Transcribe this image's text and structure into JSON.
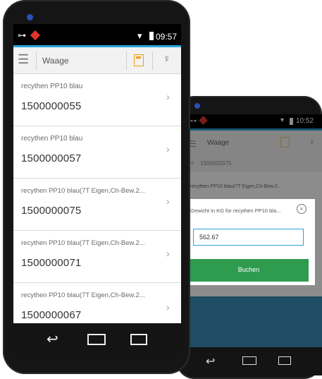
{
  "front": {
    "status": {
      "time": "09:57"
    },
    "appbar": {
      "title": "Waage"
    },
    "items": [
      {
        "subtitle": "recythen PP10 blau",
        "number": "1500000055"
      },
      {
        "subtitle": "recythen PP10 blau",
        "number": "1500000057"
      },
      {
        "subtitle": "recythen PP10 blau(7T Eigen,Ch-Bew.2...",
        "number": "1500000075"
      },
      {
        "subtitle": "recythen PP10 blau(7T Eigen,Ch-Bew.2...",
        "number": "1500000071"
      },
      {
        "subtitle": "recythen PP10 blau(7T Eigen,Ch-Bew.2...",
        "number": "1500000067"
      }
    ]
  },
  "back": {
    "status": {
      "time": "10:52"
    },
    "appbar": {
      "title": "Waage"
    },
    "breadcrumb": "1500000075",
    "item_subtitle": "recythen PP10 blau(7T Eigen,Ch-Bew.2...",
    "dialog": {
      "title": "Gewicht in KG für recythen PP10 bla...",
      "value": "562.67",
      "button": "Buchen"
    }
  },
  "colors": {
    "accent": "#29a3d9",
    "orange": "#f39c12",
    "green": "#2e9b4f"
  }
}
